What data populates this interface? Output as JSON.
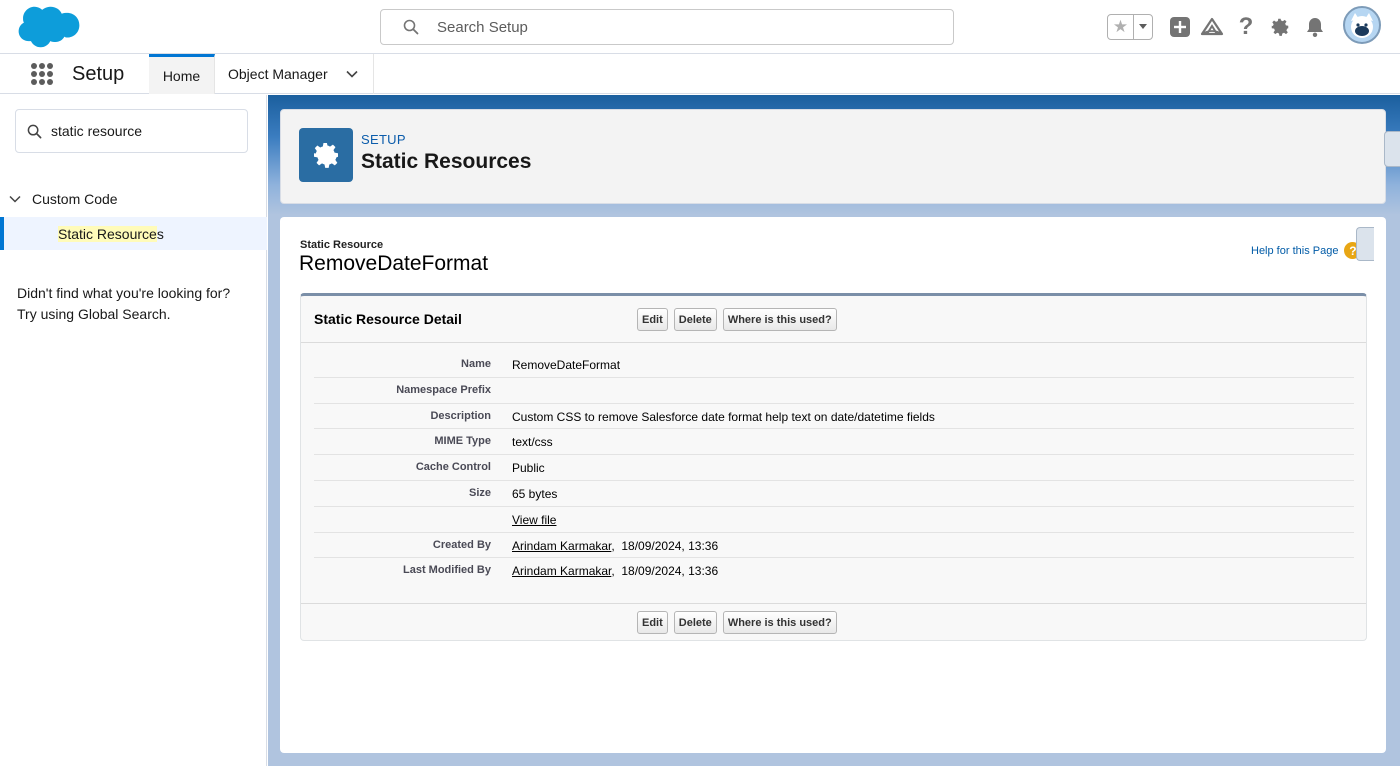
{
  "header": {
    "logo": "salesforce-cloud-logo",
    "search_placeholder": "Search Setup",
    "icons": [
      "star-icon",
      "chevron-down-icon",
      "add-icon",
      "trailhead-icon",
      "help-icon",
      "gear-icon",
      "bell-icon",
      "avatar"
    ]
  },
  "nav": {
    "app_name": "Setup",
    "tabs": [
      {
        "label": "Home",
        "active": true
      },
      {
        "label": "Object Manager",
        "active": false
      }
    ]
  },
  "sidebar": {
    "quick_find_value": "static resource",
    "group_label": "Custom Code",
    "item_highlight": "Static Resource",
    "item_rest": "s",
    "not_found_line1": "Didn't find what you're looking for?",
    "not_found_line2": "Try using Global Search."
  },
  "page_header": {
    "eyebrow": "SETUP",
    "title": "Static Resources"
  },
  "record": {
    "type": "Static Resource",
    "name": "RemoveDateFormat",
    "help_link": "Help for this Page",
    "help_icon": "?"
  },
  "detail": {
    "title": "Static Resource Detail",
    "buttons": {
      "edit": "Edit",
      "delete": "Delete",
      "where_used": "Where is this used?"
    },
    "fields": [
      {
        "label": "Name",
        "value": "RemoveDateFormat"
      },
      {
        "label": "Namespace Prefix",
        "value": ""
      },
      {
        "label": "Description",
        "value": "Custom CSS to remove Salesforce date format help text on date/datetime fields"
      },
      {
        "label": "MIME Type",
        "value": "text/css"
      },
      {
        "label": "Cache Control",
        "value": "Public"
      },
      {
        "label": "Size",
        "value": "65 bytes"
      },
      {
        "label": "",
        "link": "View file"
      },
      {
        "label": "Created By",
        "link": "Arindam Karmakar",
        "suffix": ",  18/09/2024, 13:36"
      },
      {
        "label": "Last Modified By",
        "link": "Arindam Karmakar",
        "suffix": ",  18/09/2024, 13:36"
      }
    ]
  },
  "colors": {
    "brand_blue": "#0176d3",
    "setup_icon_bg": "#2a6da3",
    "header_band": "#1b5f9e",
    "help_icon": "#e8a614"
  }
}
